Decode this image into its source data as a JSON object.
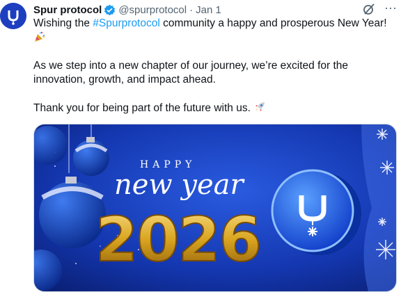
{
  "tweet": {
    "author_name": "Spur protocol",
    "handle": "@spurprotocol",
    "separator": "·",
    "date": "Jan 1",
    "line1_pre": "Wishing the ",
    "hashtag": "#Spurprotocol",
    "line1_post": " community a happy and prosperous New Year!",
    "paragraph2": "As we step into a new chapter of our journey, we’re excited for the innovation, growth, and impact ahead.",
    "paragraph3": "Thank you for being part of the future with us.",
    "more_icon": "···"
  },
  "image": {
    "happy_text": "HAPPY",
    "new_year_text": "new year",
    "year_text": "2026"
  },
  "icons": {
    "avatar": "spur-logo-icon",
    "verified": "verified-badge-icon",
    "grok": "grok-icon",
    "party": "party-popper-icon",
    "rocket": "rocket-icon"
  },
  "colors": {
    "brand_blue": "#1d3fbf",
    "hashtag": "#1d9bf0",
    "gold": "#d9a520",
    "verified": "#1d9bf0"
  }
}
